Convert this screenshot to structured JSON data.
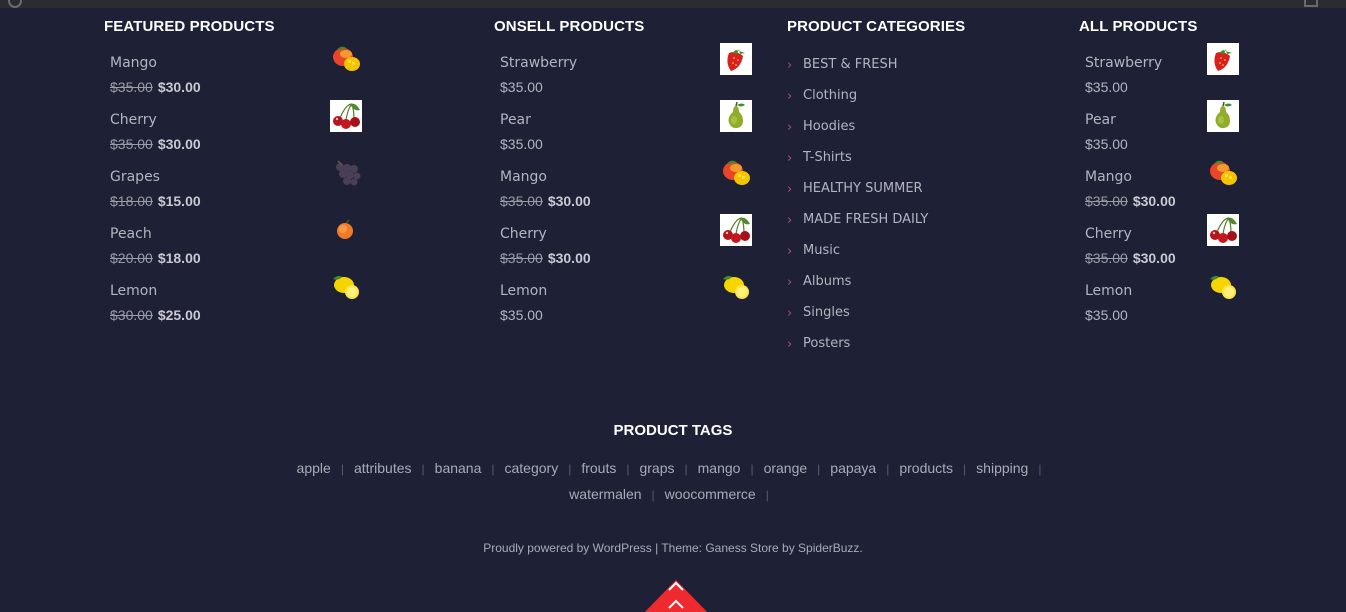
{
  "featured": {
    "title": "FEATURED PRODUCTS",
    "items": [
      {
        "name": "Mango",
        "old": "$35.00",
        "price": "$30.00",
        "icon": "mango-icon"
      },
      {
        "name": "Cherry",
        "old": "$35.00",
        "price": "$30.00",
        "icon": "cherry-icon"
      },
      {
        "name": "Grapes",
        "old": "$18.00",
        "price": "$15.00",
        "icon": "grapes-icon"
      },
      {
        "name": "Peach",
        "old": "$20.00",
        "price": "$18.00",
        "icon": "peach-icon"
      },
      {
        "name": "Lemon",
        "old": "$30.00",
        "price": "$25.00",
        "icon": "lemon-icon"
      }
    ]
  },
  "onsell": {
    "title": "ONSELL PRODUCTS",
    "items": [
      {
        "name": "Strawberry",
        "price": "$35.00",
        "icon": "strawberry-icon"
      },
      {
        "name": "Pear",
        "price": "$35.00",
        "icon": "pear-icon"
      },
      {
        "name": "Mango",
        "old": "$35.00",
        "price": "$30.00",
        "icon": "mango-icon"
      },
      {
        "name": "Cherry",
        "old": "$35.00",
        "price": "$30.00",
        "icon": "cherry-icon"
      },
      {
        "name": "Lemon",
        "price": "$35.00",
        "icon": "lemon-icon"
      }
    ]
  },
  "categories": {
    "title": "PRODUCT CATEGORIES",
    "items": [
      "BEST & FRESH",
      "Clothing",
      "Hoodies",
      "T-Shirts",
      "HEALTHY SUMMER",
      "MADE FRESH DAILY",
      "Music",
      "Albums",
      "Singles",
      "Posters"
    ]
  },
  "all": {
    "title": "ALL PRODUCTS",
    "items": [
      {
        "name": "Strawberry",
        "price": "$35.00",
        "icon": "strawberry-icon"
      },
      {
        "name": "Pear",
        "price": "$35.00",
        "icon": "pear-icon"
      },
      {
        "name": "Mango",
        "old": "$35.00",
        "price": "$30.00",
        "icon": "mango-icon"
      },
      {
        "name": "Cherry",
        "old": "$35.00",
        "price": "$30.00",
        "icon": "cherry-icon"
      },
      {
        "name": "Lemon",
        "price": "$35.00",
        "icon": "lemon-icon"
      }
    ]
  },
  "tags": {
    "title": "PRODUCT TAGS",
    "items": [
      "apple",
      "attributes",
      "banana",
      "category",
      "frouts",
      "graps",
      "mango",
      "orange",
      "papaya",
      "products",
      "shipping",
      "watermalen",
      "woocommerce"
    ]
  },
  "footer": {
    "text": "Proudly powered by WordPress | Theme: Ganess Store by SpiderBuzz."
  },
  "colors": {
    "background": "#1e2036",
    "accent": "#ee2a2f",
    "chevron": "#b04a8e"
  }
}
